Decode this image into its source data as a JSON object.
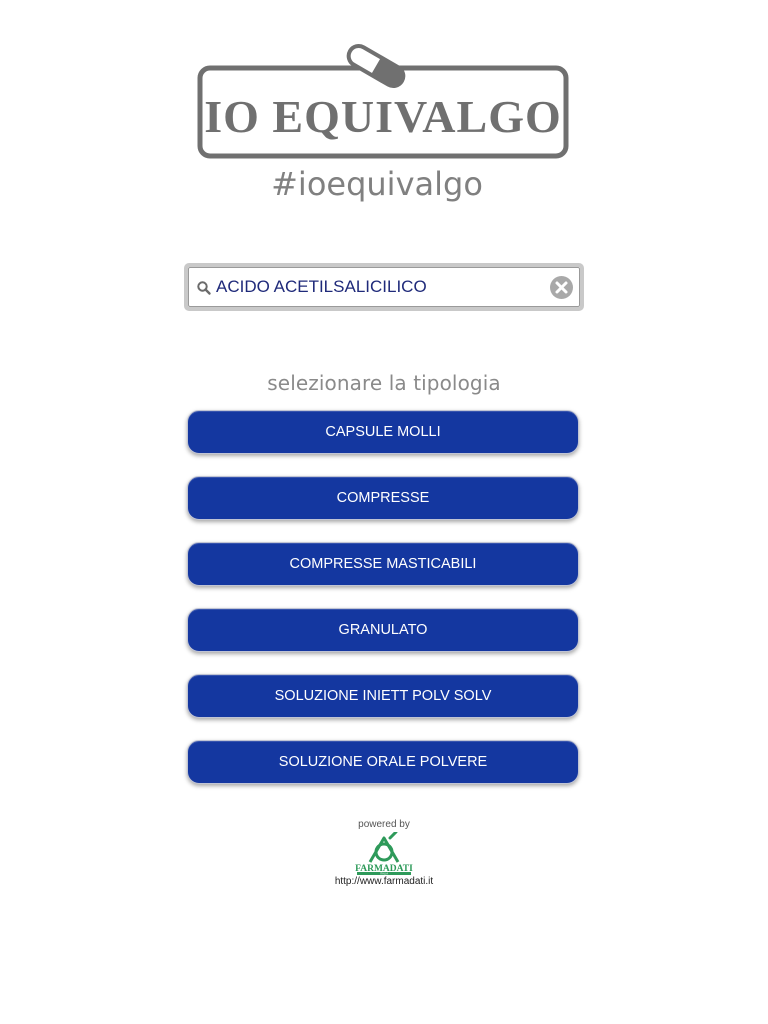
{
  "logo": {
    "title": "IO EQUIVALGO",
    "hashtag": "#ioequivalgo",
    "icon": "pill-capsule-icon",
    "color": "#707070"
  },
  "search": {
    "value": "ACIDO ACETILSALICILICO",
    "icon": "search-icon",
    "clear_icon": "clear-circle-icon"
  },
  "prompt": "selezionare la tipologia",
  "types": [
    "CAPSULE MOLLI",
    "COMPRESSE",
    "COMPRESSE MASTICABILI",
    "GRANULATO",
    "SOLUZIONE INIETT POLV SOLV",
    "SOLUZIONE ORALE POLVERE"
  ],
  "footer": {
    "powered_by": "powered by",
    "brand": "FARMADATI",
    "brand_sub": "ITALIA",
    "url": "http://www.farmadati.it",
    "brand_color": "#2e9a5a"
  },
  "colors": {
    "button": "#1437a0",
    "search_text": "#1f2a7a"
  }
}
